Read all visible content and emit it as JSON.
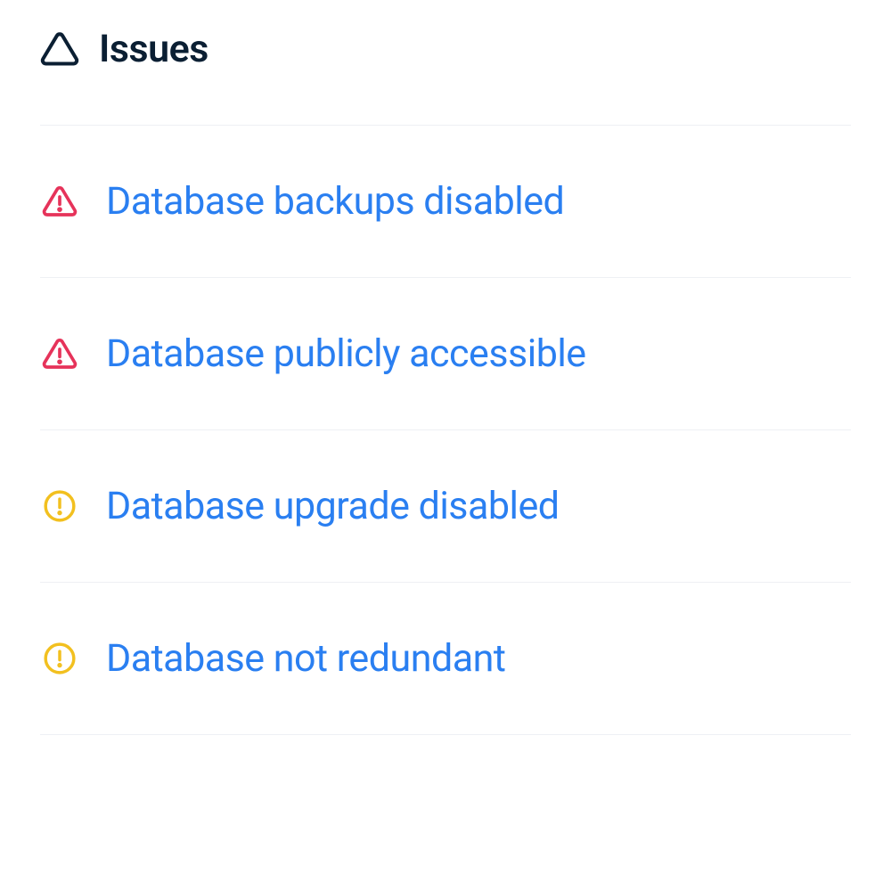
{
  "header": {
    "title": "Issues"
  },
  "colors": {
    "headerText": "#0b1f33",
    "link": "#2a7ff1",
    "critical": "#e6335a",
    "warning": "#f2c01f",
    "divider": "#eef0f4"
  },
  "issues": [
    {
      "severity": "critical",
      "label": "Database backups disabled"
    },
    {
      "severity": "critical",
      "label": "Database publicly accessible"
    },
    {
      "severity": "warning",
      "label": "Database upgrade disabled"
    },
    {
      "severity": "warning",
      "label": "Database not redundant"
    }
  ]
}
